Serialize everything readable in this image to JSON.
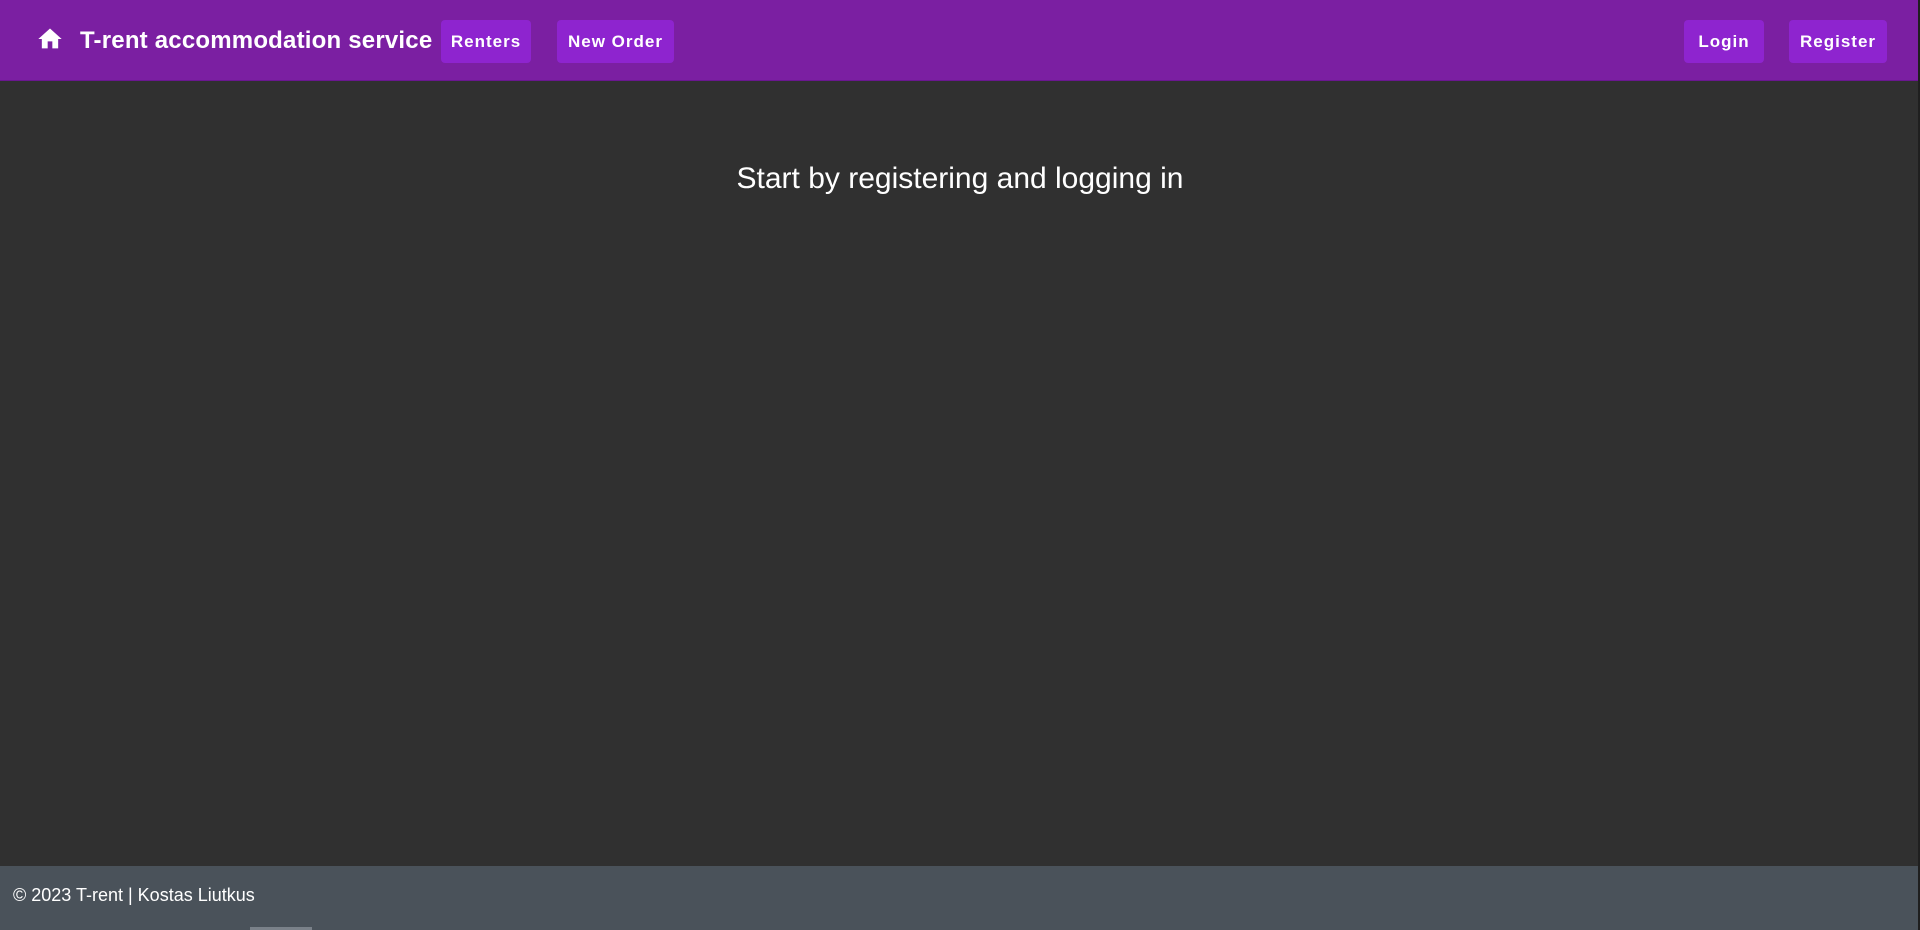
{
  "header": {
    "home_icon": "home-icon",
    "brand": "T-rent accommodation service",
    "nav": {
      "renters": "Renters",
      "new_order": "New Order"
    },
    "auth": {
      "login": "Login",
      "register": "Register"
    },
    "bg_color": "#7b1fa2",
    "button_color": "#8e24cf"
  },
  "main": {
    "headline": "Start by registering and logging in",
    "bg_color": "#303030"
  },
  "footer": {
    "text": "© 2023 T-rent | Kostas Liutkus",
    "bg_color": "#4a525a"
  }
}
